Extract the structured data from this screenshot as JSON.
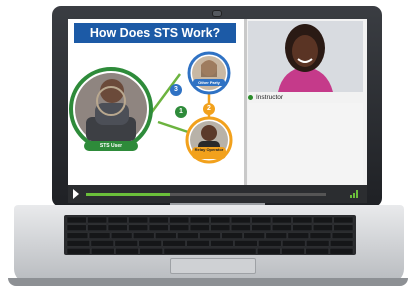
{
  "slide": {
    "title": "How Does STS Work?",
    "labels": {
      "sts_user": "STS User",
      "other_party": "Other Party",
      "relay_operator": "Relay Operator"
    },
    "steps": [
      "1",
      "2",
      "3"
    ]
  },
  "video_panel": {
    "label": "Instructor"
  },
  "player": {
    "progress": 0.35
  }
}
